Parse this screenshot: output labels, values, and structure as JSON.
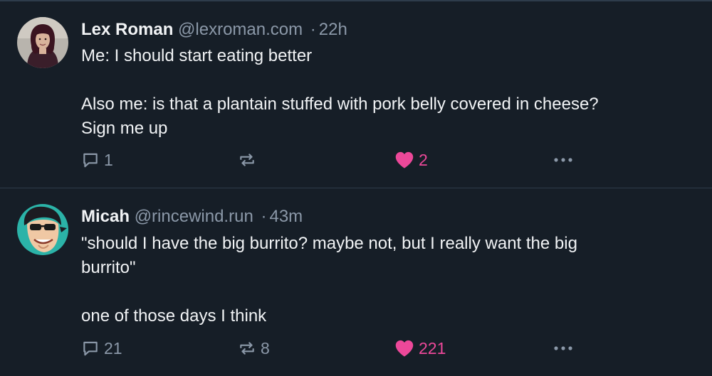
{
  "colors": {
    "background": "#161e27",
    "divider": "#2e3c4b",
    "text_primary": "#f1f3f5",
    "text_secondary": "#8b98a8",
    "like_accent": "#ec4899"
  },
  "posts": [
    {
      "author": {
        "name": "Lex Roman",
        "handle": "@lexroman.com",
        "avatar": "avatar-photo"
      },
      "separator": "·",
      "time": "22h",
      "text": "Me: I should start eating better\n\nAlso me: is that a plantain stuffed with pork belly covered in cheese?\nSign me up",
      "counts": {
        "replies": "1",
        "reposts": "",
        "likes": "2"
      },
      "liked": true,
      "icons": {
        "reply": "reply-icon",
        "repost": "repost-icon",
        "like": "heart-icon",
        "more": "more-icon"
      }
    },
    {
      "author": {
        "name": "Micah",
        "handle": "@rincewind.run",
        "avatar": "avatar-cartoon"
      },
      "separator": "·",
      "time": "43m",
      "text": "\"should I have the big burrito? maybe not, but I really want the big\nburrito\"\n\none of those days I think",
      "counts": {
        "replies": "21",
        "reposts": "8",
        "likes": "221"
      },
      "liked": true,
      "icons": {
        "reply": "reply-icon",
        "repost": "repost-icon",
        "like": "heart-icon",
        "more": "more-icon"
      }
    }
  ]
}
